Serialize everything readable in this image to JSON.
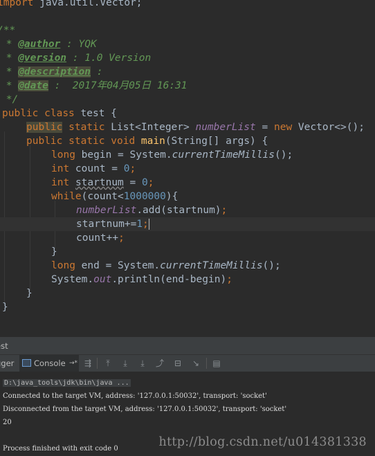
{
  "editor": {
    "import_kw": "import",
    "import_path": " java.util.Vector;",
    "doc_open": "/**",
    "doc_star": " * ",
    "author_tag": "@author",
    "author_val": " : YQK",
    "version_tag": "@version",
    "version_val": " : 1.0 Version",
    "description_tag": "@description",
    "description_val": " :",
    "date_tag": "@date",
    "date_val": " :  2017年04月05日 16:31",
    "doc_close": " */",
    "kw_public": "public",
    "kw_class": "class",
    "class_name": " test {",
    "kw_static": "static",
    "list_type": " List<Integer> ",
    "field_name": "numberList",
    "eq": " = ",
    "kw_new": "new",
    "vector_ctor": " Vector<>();",
    "kw_void": "void",
    "method_name": "main",
    "main_params": "(String[] args) {",
    "kw_long": "long",
    "begin_decl": " begin = System.",
    "current_time": "currentTimeMillis",
    "call_end": "();",
    "kw_int": "int",
    "count_decl": " count = ",
    "zero": "0",
    "semi": ";",
    "startnum_var": "startnum",
    "startnum_eq": " = ",
    "kw_while": "while",
    "while_open": "(count<",
    "limit": "1000000",
    "while_close": "){",
    "add_call": ".add(startnum)",
    "increment_lhs": "startnum+=",
    "one": "1",
    "count_inc": "count++",
    "brace_close": "}",
    "end_decl": " end = System.",
    "println_prefix": "System.",
    "out_field": "out",
    "println_suffix": ".println(end-begin)"
  },
  "tool_window": {
    "title": "est",
    "tab_debugger": "gger",
    "tab_console": "Console",
    "tab_console_arrow": "→*"
  },
  "console": {
    "command": "D:\\java_tools\\jdk\\bin\\java ...",
    "connected": "Connected to the target VM, address: '127.0.0.1:50032', transport: 'socket'",
    "disconnected": "Disconnected from the target VM, address: '127.0.0.1:50032', transport: 'socket'",
    "result": "20",
    "finished": "Process finished with exit code 0"
  },
  "watermark": "http://blog.csdn.net/u014381338",
  "colors": {
    "background": "#2b2b2b",
    "keyword": "#cc7832",
    "number": "#6897bb",
    "doc_comment": "#629755",
    "field": "#9876aa",
    "method": "#ffc66d",
    "text": "#a9b7c6"
  },
  "icons": [
    "console-icon",
    "scroll-to-end-icon",
    "step-over-icon",
    "step-into-icon",
    "force-step-into-icon",
    "step-out-icon",
    "drop-frame-icon",
    "run-to-cursor-icon",
    "evaluate-icon"
  ]
}
